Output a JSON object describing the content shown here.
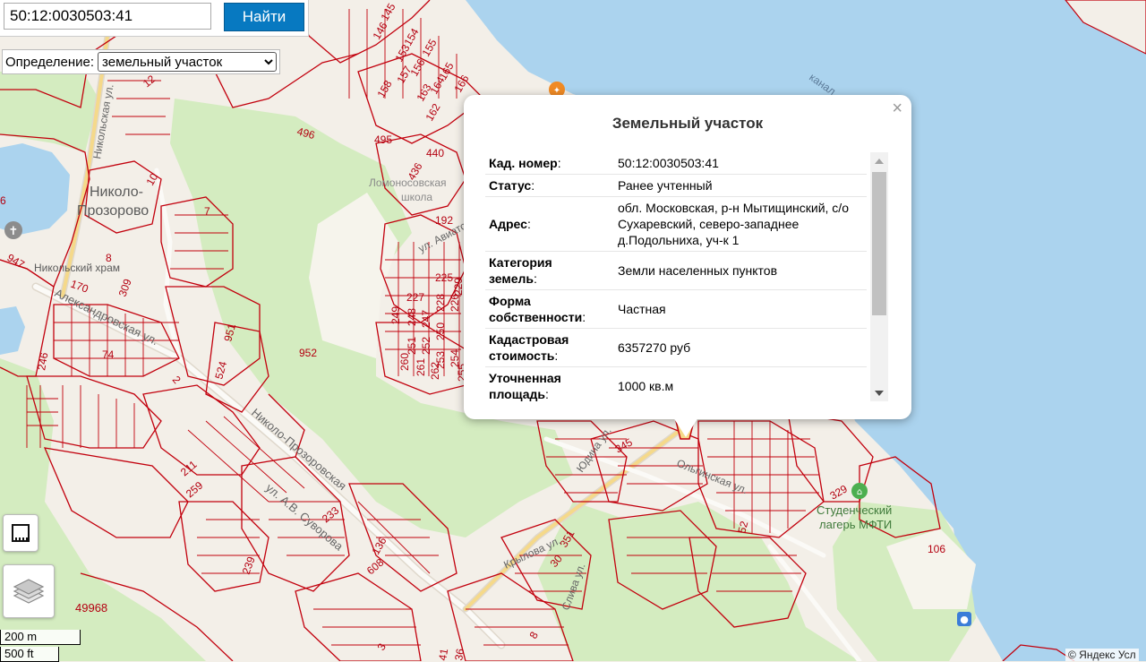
{
  "search": {
    "value": "50:12:0030503:41",
    "button_label": "Найти"
  },
  "definition": {
    "label": "Определение:",
    "selected": "земельный участок"
  },
  "popup": {
    "title": "Земельный участок",
    "close": "×",
    "rows": [
      {
        "k": "Кад. номер",
        "colon": ":",
        "v": "50:12:0030503:41"
      },
      {
        "k": "Статус",
        "colon": ":",
        "v": "Ранее учтенный"
      },
      {
        "k": "Адрес",
        "colon": ":",
        "v": "обл. Московская, р-н Мытищинский, с/о Сухаревский, северо-западнее д.Подольниха, уч-к 1"
      },
      {
        "k": "Категория земель",
        "colon": ":",
        "v": "Земли населенных пунктов"
      },
      {
        "k": "Форма собственности",
        "colon": ":",
        "v": "Частная"
      },
      {
        "k": "Кадастровая стоимость",
        "colon": ":",
        "v": "6357270 руб"
      },
      {
        "k": "Уточненная площадь",
        "colon": ":",
        "v": "1000 кв.м"
      }
    ]
  },
  "map": {
    "places": [
      "Николо-",
      "Прозорово",
      "Никольский храм",
      "Студенческий",
      "лагерь МФТИ",
      "Ломоносовская",
      "школа"
    ],
    "streets": [
      "Александровская ул.",
      "ул. А.В. Суворова",
      "Николо-Прозоровская",
      "Ольгинская ул.",
      "Юдина ул.",
      "Слива ул.",
      "Крылова ул.",
      "ул. Авиаторов",
      "Никольская ул.",
      "канал"
    ],
    "parcels": [
      "145",
      "146",
      "154",
      "153",
      "155",
      "156",
      "157",
      "165",
      "164",
      "163",
      "166",
      "158",
      "162",
      "12",
      "10",
      "7",
      "8",
      "496",
      "495",
      "440",
      "436",
      "192",
      "225",
      "227",
      "249",
      "248",
      "247",
      "228",
      "226",
      "229",
      "250",
      "260",
      "251",
      "252",
      "253",
      "254",
      "255",
      "261",
      "262",
      "170",
      "309",
      "947",
      "951",
      "524",
      "952",
      "246",
      "74",
      "2",
      "211",
      "259",
      "233",
      "239",
      "608",
      "136",
      "351",
      "30",
      "3",
      "41",
      "36",
      "8",
      "345",
      "329",
      "52",
      "106",
      "49968",
      "6"
    ],
    "colors": {
      "water": "#abd3ee",
      "green": "#d4ecc0",
      "land": "#f3efe8",
      "parcel": "#c2000d",
      "road": "#fbfaf7",
      "road_edge": "#dfd8cc"
    }
  },
  "scale": {
    "m": "200 m",
    "ft": "500 ft"
  },
  "copyright": "© Яндекс   Усл"
}
